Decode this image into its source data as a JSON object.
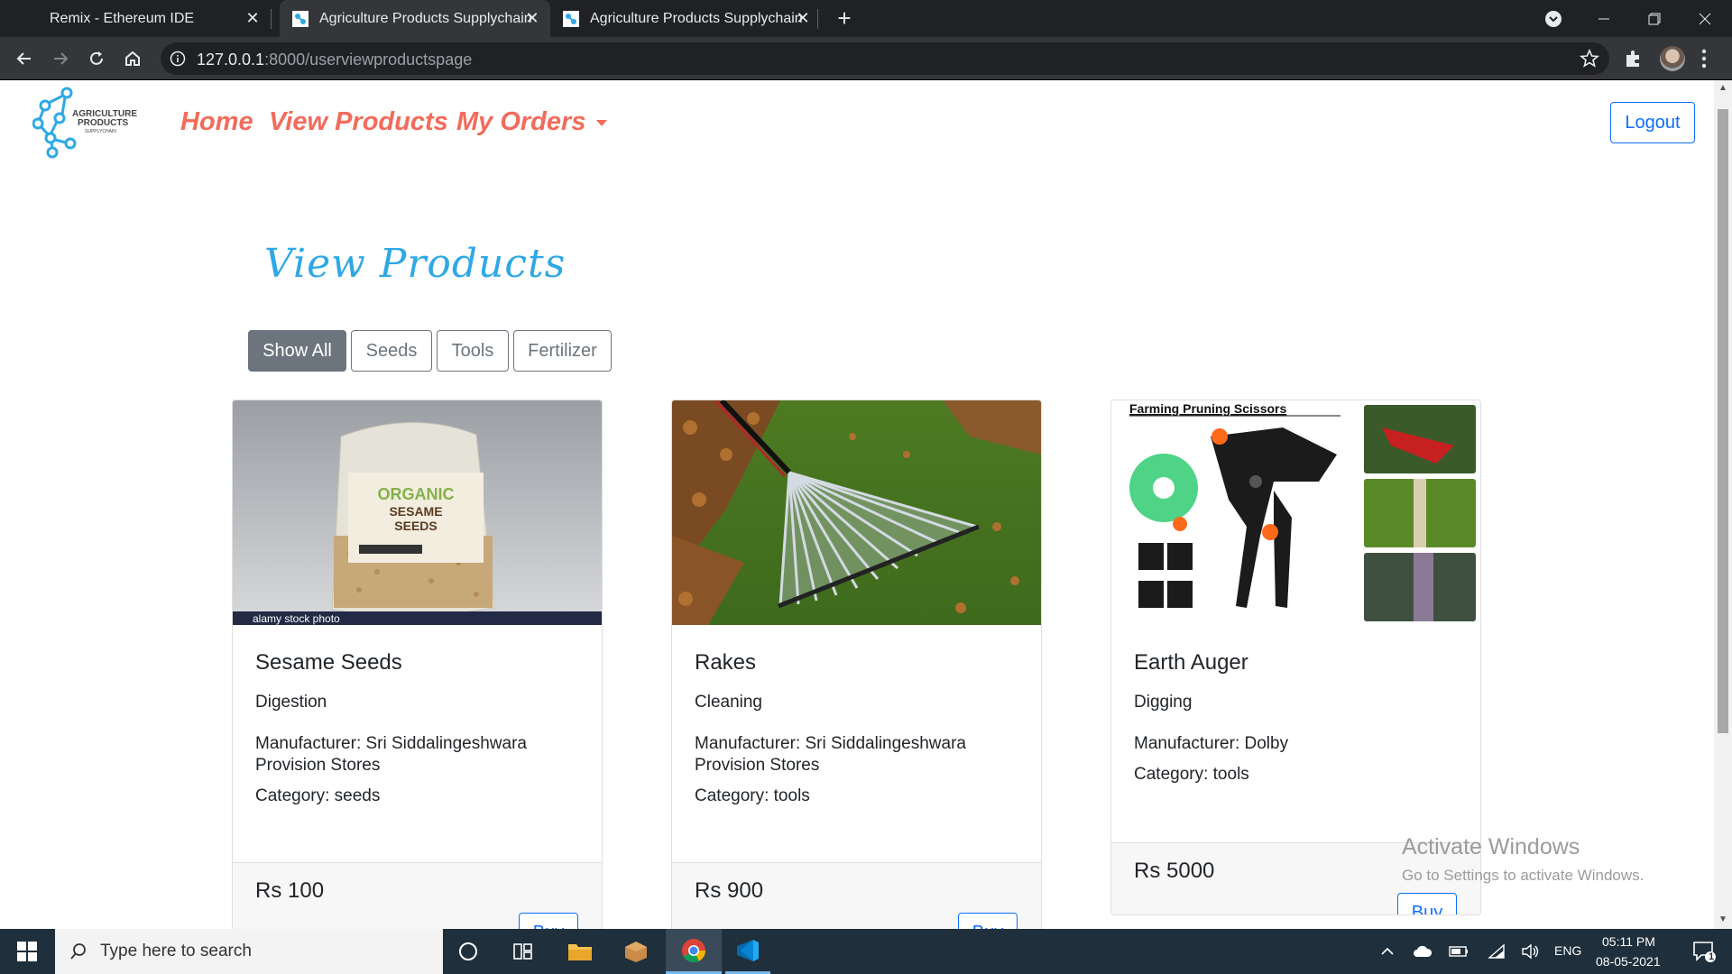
{
  "browser": {
    "tabs": [
      {
        "title": "Remix - Ethereum IDE",
        "active": false
      },
      {
        "title": "Agriculture Products Supplychain",
        "active": true
      },
      {
        "title": "Agriculture Products Supplychain",
        "active": false
      }
    ],
    "url_host": "127.0.0.1",
    "url_rest": ":8000/userviewproductspage"
  },
  "site": {
    "logo_text": "AGRICULTURE PRODUCTS SUPPLYCHAIN",
    "logo_line1": "AGRICULTURE",
    "logo_line2": "PRODUCTS",
    "logo_line3": "SUPPLYCHAIN",
    "nav": {
      "home": "Home",
      "view_products": "View Products",
      "my_orders": "My Orders"
    },
    "logout": "Logout"
  },
  "page": {
    "title": "View Products",
    "filters": [
      "Show All",
      "Seeds",
      "Tools",
      "Fertilizer"
    ],
    "active_filter": "Show All",
    "products": [
      {
        "name": "Sesame Seeds",
        "description": "Digestion",
        "manufacturer": "Manufacturer: Sri Siddalingeshwara Provision Stores",
        "category": "Category: seeds",
        "price": "Rs 100",
        "buy": "Buy",
        "image_label_1": "ORGANIC",
        "image_label_2": "SESAME",
        "image_label_3": "SEEDS",
        "image_caption": "alamy stock photo"
      },
      {
        "name": "Rakes",
        "description": "Cleaning",
        "manufacturer": "Manufacturer: Sri Siddalingeshwara Provision Stores",
        "category": "Category: tools",
        "price": "Rs 900",
        "buy": "Buy"
      },
      {
        "name": "Earth Auger",
        "description": "Digging",
        "manufacturer": "Manufacturer: Dolby",
        "category": "Category: tools",
        "price": "Rs 5000",
        "buy": "Buy",
        "image_caption": "Farming Pruning Scissors"
      }
    ]
  },
  "watermark": {
    "line1": "Activate Windows",
    "line2": "Go to Settings to activate Windows."
  },
  "taskbar": {
    "search_placeholder": "Type here to search",
    "language": "ENG",
    "time": "05:11 PM",
    "date": "08-05-2021",
    "notification_count": "1"
  },
  "colors": {
    "nav_link": "#f26b5b",
    "title": "#2ea8e6",
    "primary": "#0d6efd",
    "secondary": "#6c757d"
  }
}
